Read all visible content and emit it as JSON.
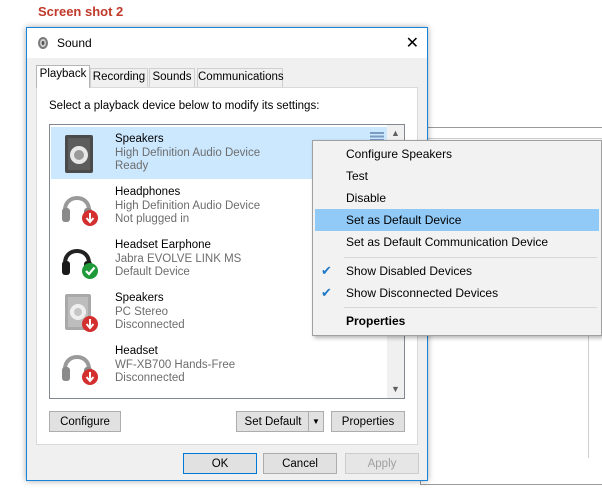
{
  "caption": "Screen shot 2",
  "dialog": {
    "title": "Sound",
    "close_glyph": "✕",
    "tabs": [
      {
        "label": "Playback",
        "active": true
      },
      {
        "label": "Recording",
        "active": false
      },
      {
        "label": "Sounds",
        "active": false
      },
      {
        "label": "Communications",
        "active": false
      }
    ],
    "instruction": "Select a playback device below to modify its settings:",
    "devices": [
      {
        "name": "Speakers",
        "line1": "High Definition Audio Device",
        "line2": "Ready",
        "icon": "speaker-icon",
        "status": "ready",
        "selected": true
      },
      {
        "name": "Headphones",
        "line1": "High Definition Audio Device",
        "line2": "Not plugged in",
        "icon": "headphones-icon",
        "status": "unplugged"
      },
      {
        "name": "Headset Earphone",
        "line1": "Jabra EVOLVE LINK MS",
        "line2": "Default Device",
        "icon": "headset-icon",
        "status": "default"
      },
      {
        "name": "Speakers",
        "line1": "PC Stereo",
        "line2": "Disconnected",
        "icon": "speaker-icon",
        "status": "disconnected"
      },
      {
        "name": "Headset",
        "line1": "WF-XB700 Hands-Free",
        "line2": "Disconnected",
        "icon": "headphones-icon",
        "status": "disconnected"
      }
    ],
    "buttons": {
      "configure": "Configure",
      "set_default": "Set Default",
      "properties": "Properties",
      "ok": "OK",
      "cancel": "Cancel",
      "apply": "Apply"
    }
  },
  "context_menu": {
    "items": [
      {
        "label": "Configure Speakers"
      },
      {
        "label": "Test"
      },
      {
        "label": "Disable"
      },
      {
        "label": "Set as Default Device",
        "highlighted": true
      },
      {
        "label": "Set as Default Communication Device"
      },
      {
        "label": "Show Disabled Devices",
        "checked": true
      },
      {
        "label": "Show Disconnected Devices",
        "checked": true
      },
      {
        "label": "Properties",
        "bold": true
      }
    ]
  },
  "colors": {
    "accent": "#0078d7",
    "selection": "#cce8ff",
    "menu_highlight": "#91c9f7",
    "status_red": "#d32f2f",
    "status_green": "#1f9a3a",
    "caption_red": "#c0392b"
  }
}
